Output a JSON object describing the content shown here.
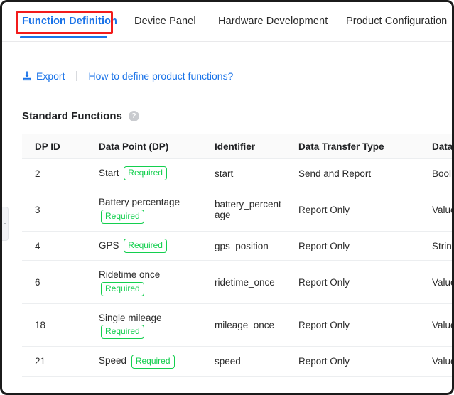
{
  "tabs": [
    {
      "label": "Function Definition",
      "active": true
    },
    {
      "label": "Device Panel",
      "active": false
    },
    {
      "label": "Hardware Development",
      "active": false
    },
    {
      "label": "Product Configuration",
      "active": false
    }
  ],
  "toolbar": {
    "export_label": "Export",
    "howto_label": "How to define product functions?",
    "export_icon": "download-icon"
  },
  "section": {
    "title": "Standard Functions",
    "help_icon": "?"
  },
  "table": {
    "columns": [
      "DP ID",
      "Data Point (DP)",
      "Identifier",
      "Data Transfer Type",
      "Data Type"
    ],
    "badge_label": "Required",
    "rows": [
      {
        "dp_id": "2",
        "data_point": "Start",
        "required": true,
        "identifier": "start",
        "transfer_type": "Send and Report",
        "data_type": "Bool"
      },
      {
        "dp_id": "3",
        "data_point": "Battery percentage",
        "required": true,
        "identifier": "battery_percentage",
        "transfer_type": "Report Only",
        "data_type": "Value"
      },
      {
        "dp_id": "4",
        "data_point": "GPS",
        "required": true,
        "identifier": "gps_position",
        "transfer_type": "Report Only",
        "data_type": "String"
      },
      {
        "dp_id": "6",
        "data_point": "Ridetime once",
        "required": true,
        "identifier": "ridetime_once",
        "transfer_type": "Report Only",
        "data_type": "Value"
      },
      {
        "dp_id": "18",
        "data_point": "Single mileage",
        "required": true,
        "identifier": "mileage_once",
        "transfer_type": "Report Only",
        "data_type": "Value"
      },
      {
        "dp_id": "21",
        "data_point": "Speed",
        "required": true,
        "identifier": "speed",
        "transfer_type": "Report Only",
        "data_type": "Value"
      }
    ]
  },
  "colors": {
    "accent_blue": "#1a73e8",
    "badge_green": "#13cf4e",
    "highlight_red": "#f21b1b"
  }
}
